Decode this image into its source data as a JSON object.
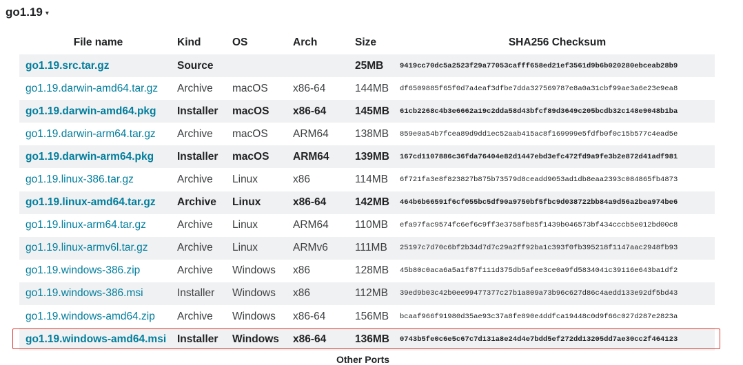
{
  "version": {
    "label": "go1.19"
  },
  "icons": {
    "caret": "caret-down-icon"
  },
  "colors": {
    "link": "#007d9c",
    "highlight": "#d9382e",
    "row_alt": "#f0f1f2"
  },
  "table": {
    "headers": {
      "file": "File name",
      "kind": "Kind",
      "os": "OS",
      "arch": "Arch",
      "size": "Size",
      "checksum": "SHA256 Checksum"
    },
    "rows": [
      {
        "file": "go1.19.src.tar.gz",
        "kind": "Source",
        "os": "",
        "arch": "",
        "size": "25MB",
        "checksum": "9419cc70dc5a2523f29a77053cafff658ed21ef3561d9b6b020280ebceab28b9",
        "primary": true
      },
      {
        "file": "go1.19.darwin-amd64.tar.gz",
        "kind": "Archive",
        "os": "macOS",
        "arch": "x86-64",
        "size": "144MB",
        "checksum": "df6509885f65f0d7a4eaf3dfbe7dda327569787e8a0a31cbf99ae3a6e23e9ea8",
        "primary": false
      },
      {
        "file": "go1.19.darwin-amd64.pkg",
        "kind": "Installer",
        "os": "macOS",
        "arch": "x86-64",
        "size": "145MB",
        "checksum": "61cb2268c4b3e6662a19c2dda58d43bfcf89d3649c205bcdb32c148e9048b1ba",
        "primary": true
      },
      {
        "file": "go1.19.darwin-arm64.tar.gz",
        "kind": "Archive",
        "os": "macOS",
        "arch": "ARM64",
        "size": "138MB",
        "checksum": "859e0a54b7fcea89d9dd1ec52aab415ac8f169999e5fdfb0f0c15b577c4ead5e",
        "primary": false
      },
      {
        "file": "go1.19.darwin-arm64.pkg",
        "kind": "Installer",
        "os": "macOS",
        "arch": "ARM64",
        "size": "139MB",
        "checksum": "167cd1107886c36fda76404e82d1447ebd3efc472fd9a9fe3b2e872d41adf981",
        "primary": true
      },
      {
        "file": "go1.19.linux-386.tar.gz",
        "kind": "Archive",
        "os": "Linux",
        "arch": "x86",
        "size": "114MB",
        "checksum": "6f721fa3e8f823827b875b73579d8ceadd9053ad1db8eaa2393c084865fb4873",
        "primary": false
      },
      {
        "file": "go1.19.linux-amd64.tar.gz",
        "kind": "Archive",
        "os": "Linux",
        "arch": "x86-64",
        "size": "142MB",
        "checksum": "464b6b66591f6cf055bc5df90a9750bf5fbc9d038722bb84a9d56a2bea974be6",
        "primary": true
      },
      {
        "file": "go1.19.linux-arm64.tar.gz",
        "kind": "Archive",
        "os": "Linux",
        "arch": "ARM64",
        "size": "110MB",
        "checksum": "efa97fac9574fc6ef6c9ff3e3758fb85f1439b046573bf434cccb5e012bd00c8",
        "primary": false
      },
      {
        "file": "go1.19.linux-armv6l.tar.gz",
        "kind": "Archive",
        "os": "Linux",
        "arch": "ARMv6",
        "size": "111MB",
        "checksum": "25197c7d70c6bf2b34d7d7c29a2ff92ba1c393f0fb395218f1147aac2948fb93",
        "primary": false
      },
      {
        "file": "go1.19.windows-386.zip",
        "kind": "Archive",
        "os": "Windows",
        "arch": "x86",
        "size": "128MB",
        "checksum": "45b80c0aca6a5a1f87f111d375db5afee3ce0a9fd5834041c39116e643ba1df2",
        "primary": false
      },
      {
        "file": "go1.19.windows-386.msi",
        "kind": "Installer",
        "os": "Windows",
        "arch": "x86",
        "size": "112MB",
        "checksum": "39ed9b03c42b0ee99477377c27b1a809a73b96c627d86c4aedd133e92df5bd43",
        "primary": false
      },
      {
        "file": "go1.19.windows-amd64.zip",
        "kind": "Archive",
        "os": "Windows",
        "arch": "x86-64",
        "size": "156MB",
        "checksum": "bcaaf966f91980d35ae93c37a8fe890e4ddfca19448c0d9f66c027d287e2823a",
        "primary": false
      },
      {
        "file": "go1.19.windows-amd64.msi",
        "kind": "Installer",
        "os": "Windows",
        "arch": "x86-64",
        "size": "136MB",
        "checksum": "0743b5fe0c6e5c67c7d131a8e24d4e7bdd5ef272dd13205dd7ae30cc2f464123",
        "primary": true,
        "highlighted": true
      }
    ]
  },
  "footer": {
    "other_ports": "Other Ports"
  }
}
